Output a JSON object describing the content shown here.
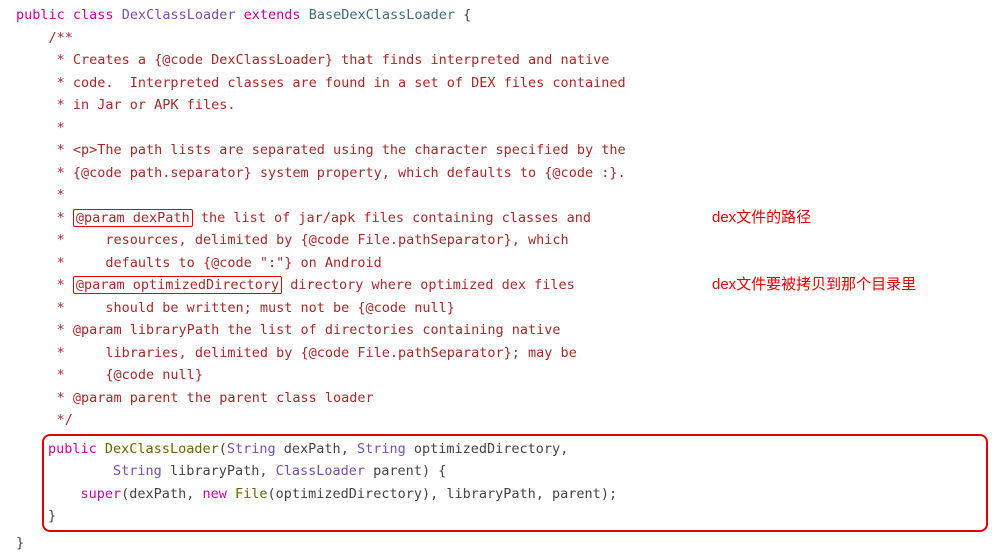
{
  "decl": {
    "public": "public",
    "class": "class",
    "name": "DexClassLoader",
    "extends": "extends",
    "base": "BaseDexClassLoader",
    "open": "{"
  },
  "com": {
    "o": "/**",
    "c1": " * Creates a {@code DexClassLoader} that finds interpreted and native",
    "c2": " * code.  Interpreted classes are found in a set of DEX files contained",
    "c3": " * in Jar or APK files.",
    "blank": " *",
    "c4": " * <p>The path lists are separated using the character specified by the",
    "c5": " * {@code path.separator} system property, which defaults to {@code :}.",
    "p1tag": "@param dexPath",
    "p1rest": "the list of jar/apk files containing classes and",
    "p1a": " *     resources, delimited by {@code File.pathSeparator}, which",
    "p1b": " *     defaults to {@code \":\"} on Android",
    "p2tag": "@param optimizedDirectory",
    "p2rest": "directory where optimized dex files",
    "p2a": " *     should be written; must not be {@code null}",
    "p3": " * @param libraryPath the list of directories containing native",
    "p3a": " *     libraries, delimited by {@code File.pathSeparator}; may be",
    "p3b": " *     {@code null}",
    "p4": " * @param parent the parent class loader",
    "e": " */"
  },
  "annot": {
    "a1": "dex文件的路径",
    "a2": "dex文件要被拷贝到那个目录里"
  },
  "ctor": {
    "public": "public",
    "name": "DexClassLoader",
    "String": "String",
    "dexPath": "dexPath",
    "optimizedDirectory": "optimizedDirectory",
    "libraryPath": "libraryPath",
    "ClassLoader": "ClassLoader",
    "parent": "parent",
    "open": "{",
    "super": "super",
    "new": "new",
    "File": "File",
    "close": "}"
  },
  "closeClass": "}"
}
